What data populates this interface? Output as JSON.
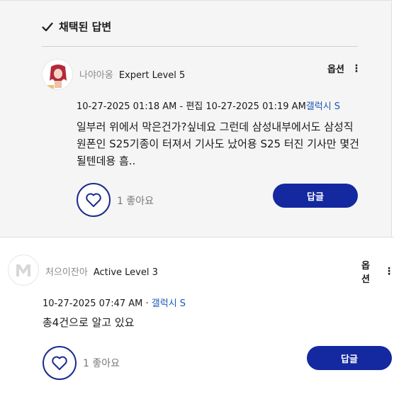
{
  "accepted": {
    "title": "채택된 답변",
    "author": {
      "name": "나야아옹",
      "rank": "Expert Level 5"
    },
    "options_label": "옵션",
    "options_dots": "⋮",
    "meta": {
      "posted": "10-27-2025 01:18 AM",
      "edit_prefix": " - 편집 ",
      "edited": "10-27-2025 01:19 AM",
      "category": "갤럭시 S"
    },
    "body": "일부러 위에서 막은건가?싶네요 그런데 삼성내부에서도 삼성직원폰인 S25기종이 터져서 기사도 났어용 S25 터진 기사만 몇건 될텐데용 흠..",
    "likes": "1 좋아요",
    "reply_label": "답글"
  },
  "reply2": {
    "author": {
      "name": "처으이잔아",
      "rank": "Active Level 3"
    },
    "options_label": "옵션",
    "options_dots": "⋮",
    "meta": {
      "posted": "10-27-2025 07:47 AM",
      "separator": " · ",
      "category": "갤럭시 S"
    },
    "body": "총4건으로 알고 있요",
    "likes": "1 좋아요",
    "reply_label": "답글"
  },
  "colors": {
    "accent": "#1428a0",
    "link": "#1a58b5",
    "accepted_bg": "#f5f5f5"
  },
  "icons": [
    "check-icon",
    "heart-icon",
    "more-vertical-icon",
    "avatar-icon"
  ]
}
